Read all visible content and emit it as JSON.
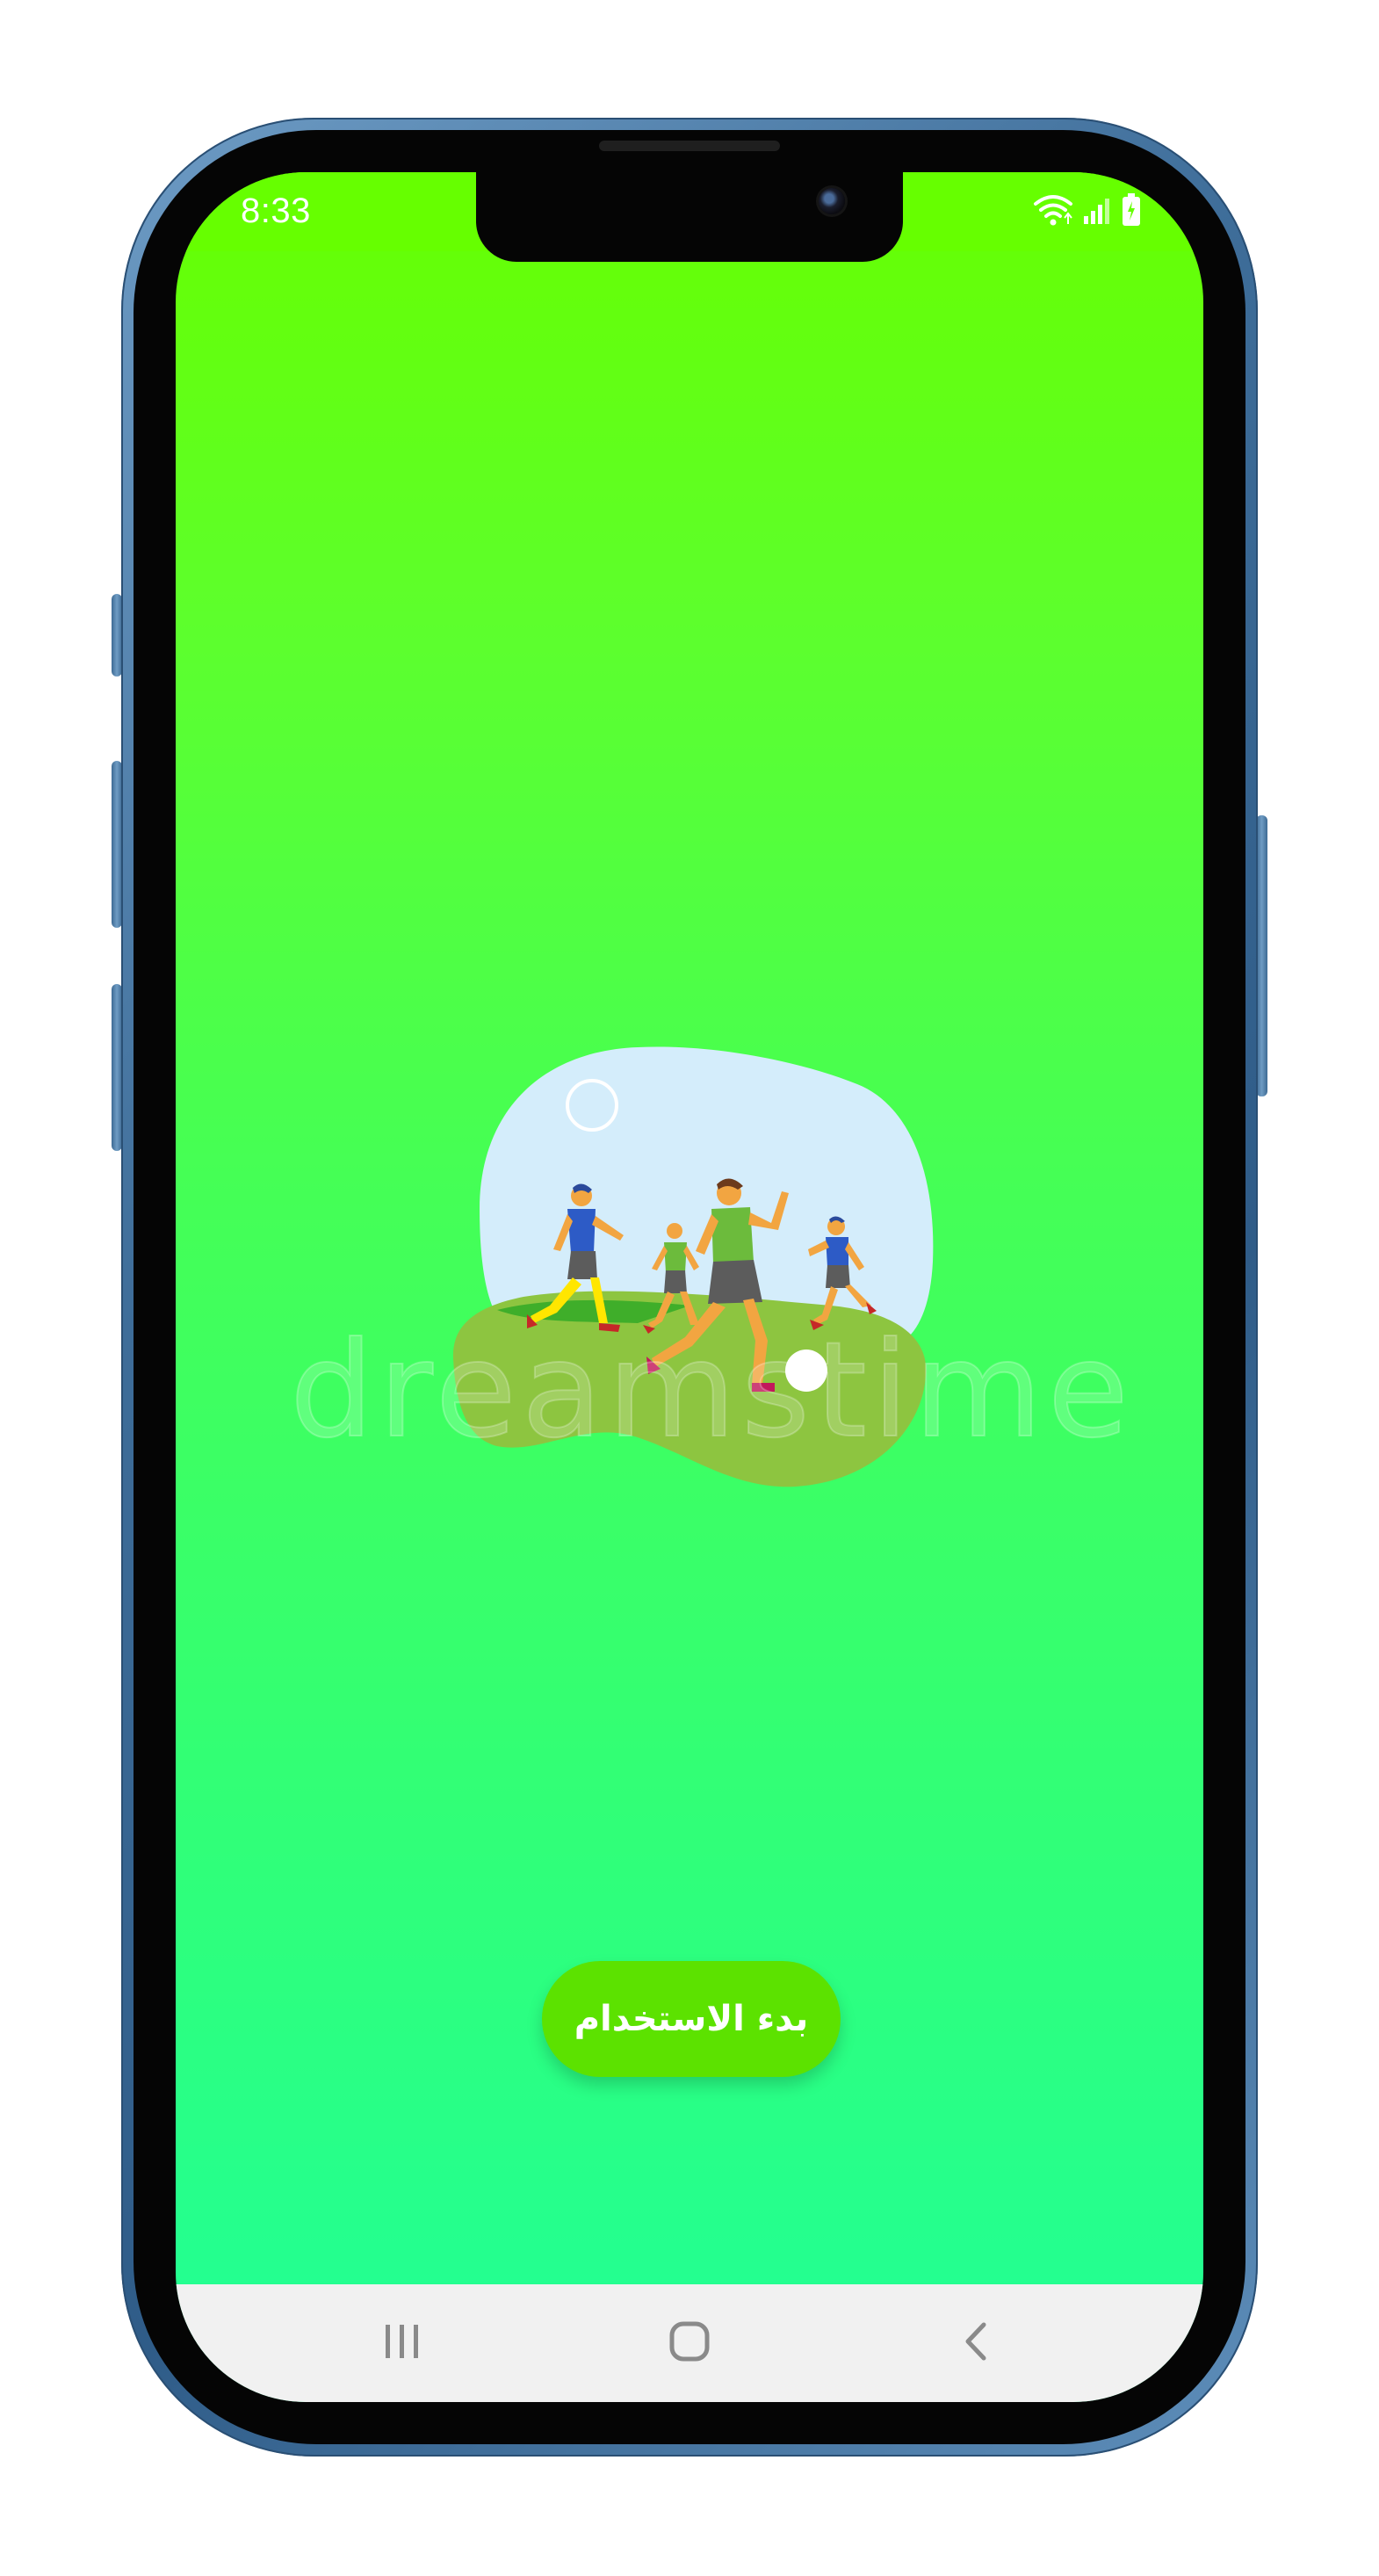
{
  "status_bar": {
    "time": "8:33",
    "icons": [
      "wifi-icon",
      "signal-icon",
      "battery-icon"
    ]
  },
  "main": {
    "illustration": "people-playing-soccer-illustration",
    "watermark_text": "dreamstime",
    "start_button_label": "بدء الاستخدام"
  },
  "nav_bar": {
    "items": [
      "recents-icon",
      "home-icon",
      "back-icon"
    ]
  },
  "colors": {
    "gradient_top": "#66ff00",
    "gradient_bottom": "#20ff96",
    "button": "#5ce200",
    "nav_background": "#f1f1f1",
    "frame": "#3e6d99"
  }
}
